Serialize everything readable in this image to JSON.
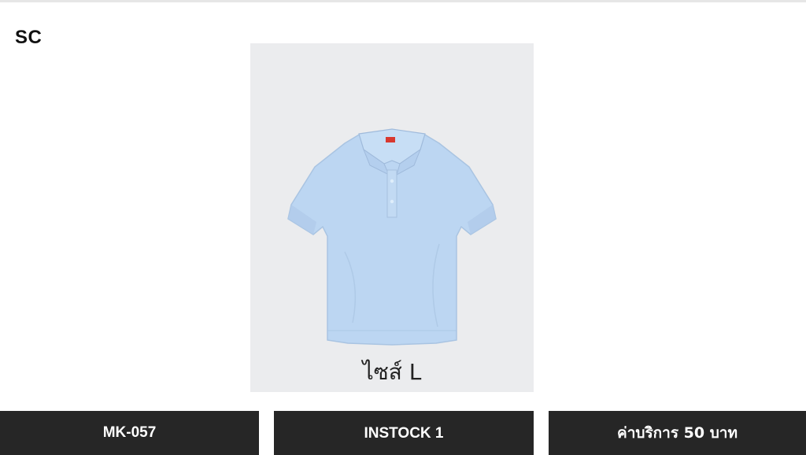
{
  "header": {
    "brand": "SC"
  },
  "product": {
    "size_label": "ไซส์ L",
    "image_icon": "polo-shirt-icon",
    "shirt_color": "#bcd6f2",
    "card_background": "#ebecee"
  },
  "footer": {
    "code": "MK-057",
    "stock": "INSTOCK 1",
    "fee": "ค่าบริการ 50  บาท"
  },
  "colors": {
    "bar_background": "#262626",
    "bar_text": "#ffffff"
  }
}
